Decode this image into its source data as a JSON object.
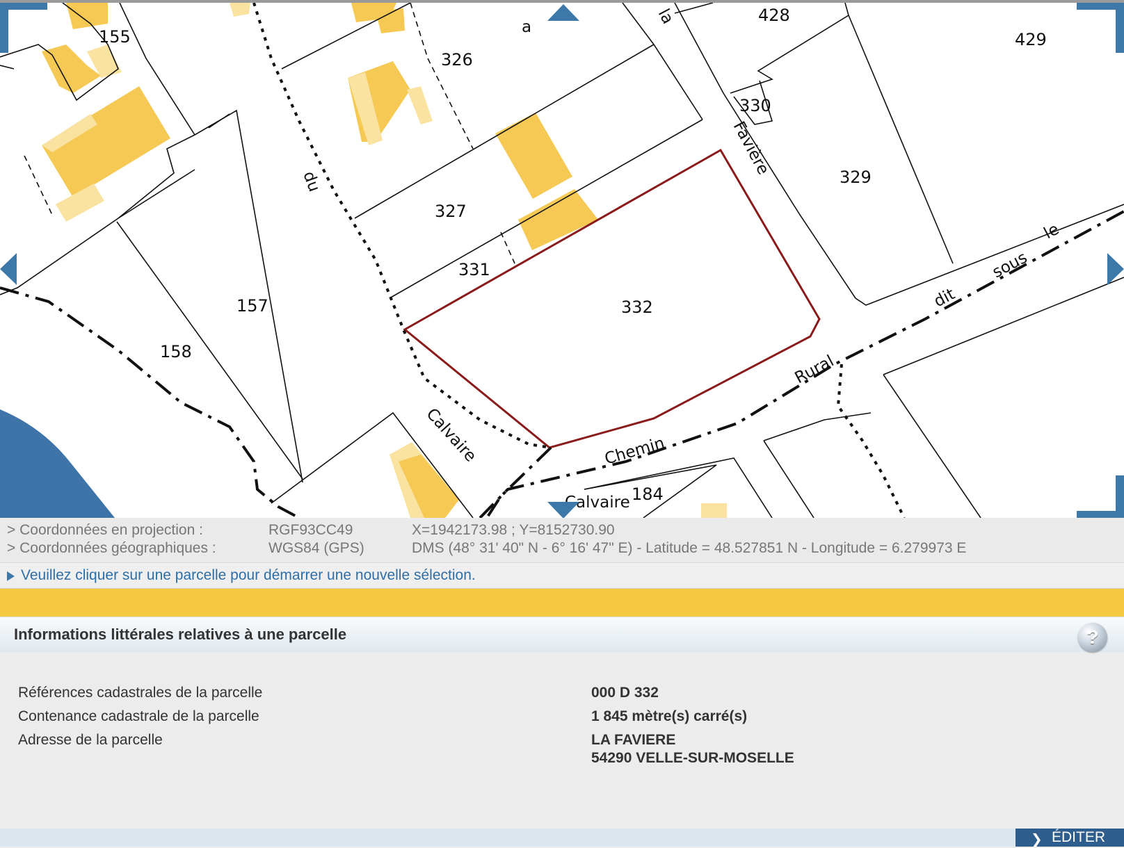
{
  "map": {
    "parcel_labels": [
      "155",
      "326",
      "428",
      "429",
      "330",
      "329",
      "327",
      "331",
      "332",
      "157",
      "158",
      "184"
    ],
    "street_labels": [
      "a",
      "la",
      "Favière",
      "du",
      "Calvaire",
      "Chemin",
      "Rural",
      "dit",
      "sous",
      "le",
      "Calvaire"
    ],
    "selected_parcel": "332",
    "colors": {
      "building": "#f5c954",
      "building_light": "#fae2a0",
      "selection": "#8b1a1a",
      "water": "#3e74a8",
      "nav": "#3e78a8"
    }
  },
  "coordinates": {
    "projection_label": "> Coordonnées en projection :",
    "projection_system": "RGF93CC49",
    "projection_value": "X=1942173.98 ; Y=8152730.90",
    "geographic_label": "> Coordonnées géographiques :",
    "geographic_system": "WGS84 (GPS)",
    "geographic_value": "DMS (48° 31' 40\" N - 6° 16' 47\" E) - Latitude = 48.527851 N - Longitude = 6.279973 E"
  },
  "hint": "Veuillez cliquer sur une parcelle pour démarrer une nouvelle sélection.",
  "panel": {
    "title": "Informations littérales relatives à une parcelle",
    "help": "?",
    "rows": {
      "ref_label": "Références cadastrales de la parcelle",
      "ref_value": "000 D 332",
      "area_label": "Contenance cadastrale de la parcelle",
      "area_value": "1 845 mètre(s) carré(s)",
      "address_label": "Adresse de la parcelle",
      "address_line1": "LA FAVIERE",
      "address_line2": "54290 VELLE-SUR-MOSELLE"
    }
  },
  "footer": {
    "edit_label": "ÉDITER",
    "edit_icon": "chevron-right-icon"
  }
}
